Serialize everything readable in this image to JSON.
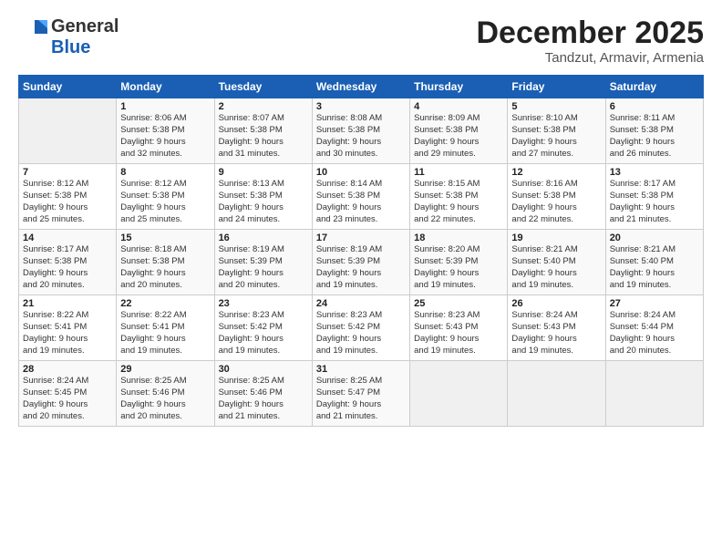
{
  "logo": {
    "general": "General",
    "blue": "Blue",
    "tagline": "GeneralBlue"
  },
  "header": {
    "month": "December 2025",
    "location": "Tandzut, Armavir, Armenia"
  },
  "weekdays": [
    "Sunday",
    "Monday",
    "Tuesday",
    "Wednesday",
    "Thursday",
    "Friday",
    "Saturday"
  ],
  "weeks": [
    [
      {
        "day": "",
        "info": ""
      },
      {
        "day": "1",
        "info": "Sunrise: 8:06 AM\nSunset: 5:38 PM\nDaylight: 9 hours\nand 32 minutes."
      },
      {
        "day": "2",
        "info": "Sunrise: 8:07 AM\nSunset: 5:38 PM\nDaylight: 9 hours\nand 31 minutes."
      },
      {
        "day": "3",
        "info": "Sunrise: 8:08 AM\nSunset: 5:38 PM\nDaylight: 9 hours\nand 30 minutes."
      },
      {
        "day": "4",
        "info": "Sunrise: 8:09 AM\nSunset: 5:38 PM\nDaylight: 9 hours\nand 29 minutes."
      },
      {
        "day": "5",
        "info": "Sunrise: 8:10 AM\nSunset: 5:38 PM\nDaylight: 9 hours\nand 27 minutes."
      },
      {
        "day": "6",
        "info": "Sunrise: 8:11 AM\nSunset: 5:38 PM\nDaylight: 9 hours\nand 26 minutes."
      }
    ],
    [
      {
        "day": "7",
        "info": "Sunrise: 8:12 AM\nSunset: 5:38 PM\nDaylight: 9 hours\nand 25 minutes."
      },
      {
        "day": "8",
        "info": "Sunrise: 8:12 AM\nSunset: 5:38 PM\nDaylight: 9 hours\nand 25 minutes."
      },
      {
        "day": "9",
        "info": "Sunrise: 8:13 AM\nSunset: 5:38 PM\nDaylight: 9 hours\nand 24 minutes."
      },
      {
        "day": "10",
        "info": "Sunrise: 8:14 AM\nSunset: 5:38 PM\nDaylight: 9 hours\nand 23 minutes."
      },
      {
        "day": "11",
        "info": "Sunrise: 8:15 AM\nSunset: 5:38 PM\nDaylight: 9 hours\nand 22 minutes."
      },
      {
        "day": "12",
        "info": "Sunrise: 8:16 AM\nSunset: 5:38 PM\nDaylight: 9 hours\nand 22 minutes."
      },
      {
        "day": "13",
        "info": "Sunrise: 8:17 AM\nSunset: 5:38 PM\nDaylight: 9 hours\nand 21 minutes."
      }
    ],
    [
      {
        "day": "14",
        "info": "Sunrise: 8:17 AM\nSunset: 5:38 PM\nDaylight: 9 hours\nand 20 minutes."
      },
      {
        "day": "15",
        "info": "Sunrise: 8:18 AM\nSunset: 5:38 PM\nDaylight: 9 hours\nand 20 minutes."
      },
      {
        "day": "16",
        "info": "Sunrise: 8:19 AM\nSunset: 5:39 PM\nDaylight: 9 hours\nand 20 minutes."
      },
      {
        "day": "17",
        "info": "Sunrise: 8:19 AM\nSunset: 5:39 PM\nDaylight: 9 hours\nand 19 minutes."
      },
      {
        "day": "18",
        "info": "Sunrise: 8:20 AM\nSunset: 5:39 PM\nDaylight: 9 hours\nand 19 minutes."
      },
      {
        "day": "19",
        "info": "Sunrise: 8:21 AM\nSunset: 5:40 PM\nDaylight: 9 hours\nand 19 minutes."
      },
      {
        "day": "20",
        "info": "Sunrise: 8:21 AM\nSunset: 5:40 PM\nDaylight: 9 hours\nand 19 minutes."
      }
    ],
    [
      {
        "day": "21",
        "info": "Sunrise: 8:22 AM\nSunset: 5:41 PM\nDaylight: 9 hours\nand 19 minutes."
      },
      {
        "day": "22",
        "info": "Sunrise: 8:22 AM\nSunset: 5:41 PM\nDaylight: 9 hours\nand 19 minutes."
      },
      {
        "day": "23",
        "info": "Sunrise: 8:23 AM\nSunset: 5:42 PM\nDaylight: 9 hours\nand 19 minutes."
      },
      {
        "day": "24",
        "info": "Sunrise: 8:23 AM\nSunset: 5:42 PM\nDaylight: 9 hours\nand 19 minutes."
      },
      {
        "day": "25",
        "info": "Sunrise: 8:23 AM\nSunset: 5:43 PM\nDaylight: 9 hours\nand 19 minutes."
      },
      {
        "day": "26",
        "info": "Sunrise: 8:24 AM\nSunset: 5:43 PM\nDaylight: 9 hours\nand 19 minutes."
      },
      {
        "day": "27",
        "info": "Sunrise: 8:24 AM\nSunset: 5:44 PM\nDaylight: 9 hours\nand 20 minutes."
      }
    ],
    [
      {
        "day": "28",
        "info": "Sunrise: 8:24 AM\nSunset: 5:45 PM\nDaylight: 9 hours\nand 20 minutes."
      },
      {
        "day": "29",
        "info": "Sunrise: 8:25 AM\nSunset: 5:46 PM\nDaylight: 9 hours\nand 20 minutes."
      },
      {
        "day": "30",
        "info": "Sunrise: 8:25 AM\nSunset: 5:46 PM\nDaylight: 9 hours\nand 21 minutes."
      },
      {
        "day": "31",
        "info": "Sunrise: 8:25 AM\nSunset: 5:47 PM\nDaylight: 9 hours\nand 21 minutes."
      },
      {
        "day": "",
        "info": ""
      },
      {
        "day": "",
        "info": ""
      },
      {
        "day": "",
        "info": ""
      }
    ]
  ]
}
